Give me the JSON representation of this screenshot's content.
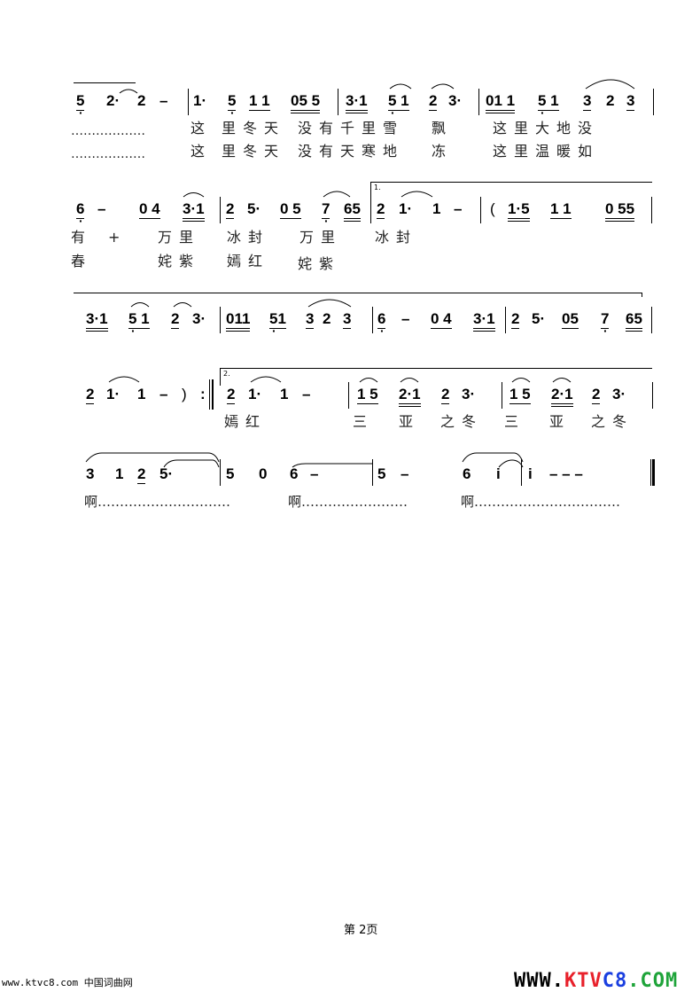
{
  "line1": {
    "notes": [
      "5",
      "2·",
      "2",
      "–",
      "1·",
      "5",
      "1 1",
      "05 5",
      "3·1",
      "5 1",
      "2",
      "3·",
      "01 1",
      "5 1",
      "3",
      "2",
      "3"
    ],
    "lyrics1": [
      "………………",
      "这",
      "里冬天",
      "没有千里雪",
      "飘",
      "这里大地没"
    ],
    "lyrics2": [
      "………………",
      "这",
      "里冬天",
      "没有天寒地",
      "冻",
      "这里温暖如"
    ]
  },
  "line2": {
    "notes": [
      "6",
      "–",
      "0 4",
      "3·1",
      "2",
      "5·",
      "0 5",
      "7",
      "65",
      "2",
      "1·",
      "1",
      "–",
      "(",
      "1·5",
      "1 1",
      "0 55"
    ],
    "volta": "1.",
    "lyrics1": [
      "有",
      "+",
      "万里",
      "冰封",
      "万里",
      "冰封"
    ],
    "lyrics2": [
      "春",
      "姹紫",
      "嫣红",
      "姹紫"
    ]
  },
  "line3": {
    "notes": [
      "3·1",
      "5 1",
      "2",
      "3·",
      "011",
      "51",
      "3",
      "2",
      "3",
      "6",
      "–",
      "0 4",
      "3·1",
      "2",
      "5·",
      "05",
      "7",
      "65"
    ]
  },
  "line4": {
    "notes": [
      "2",
      "1·",
      "1",
      "–",
      ")",
      ":",
      "2",
      "1·",
      "1",
      "–",
      "1 5",
      "2·1",
      "2",
      "3·",
      "1 5",
      "2·1",
      "2",
      "3·"
    ],
    "volta": "2.",
    "lyrics": [
      "嫣红",
      "三",
      "亚",
      "之冬",
      "三",
      "亚",
      "之冬"
    ]
  },
  "line5": {
    "notes": [
      "3",
      "1",
      "2",
      "5·",
      "5",
      "0",
      "6",
      "–",
      "5",
      "–",
      "6",
      "i",
      "i",
      "– – –"
    ],
    "lyrics": [
      "啊…………………………",
      "啊……………………",
      "啊……………………………"
    ]
  },
  "footer": {
    "page": "第 2页",
    "site": "www.ktvc8.com 中国词曲网",
    "logo_www": "WWW.",
    "logo_ktv": "KTV",
    "logo_c8": "C8",
    ".com": ".COM",
    "colors": {
      "ktv": "#e8202a",
      "c8": "#1a3fe0",
      "com": "#1fa43a"
    }
  }
}
